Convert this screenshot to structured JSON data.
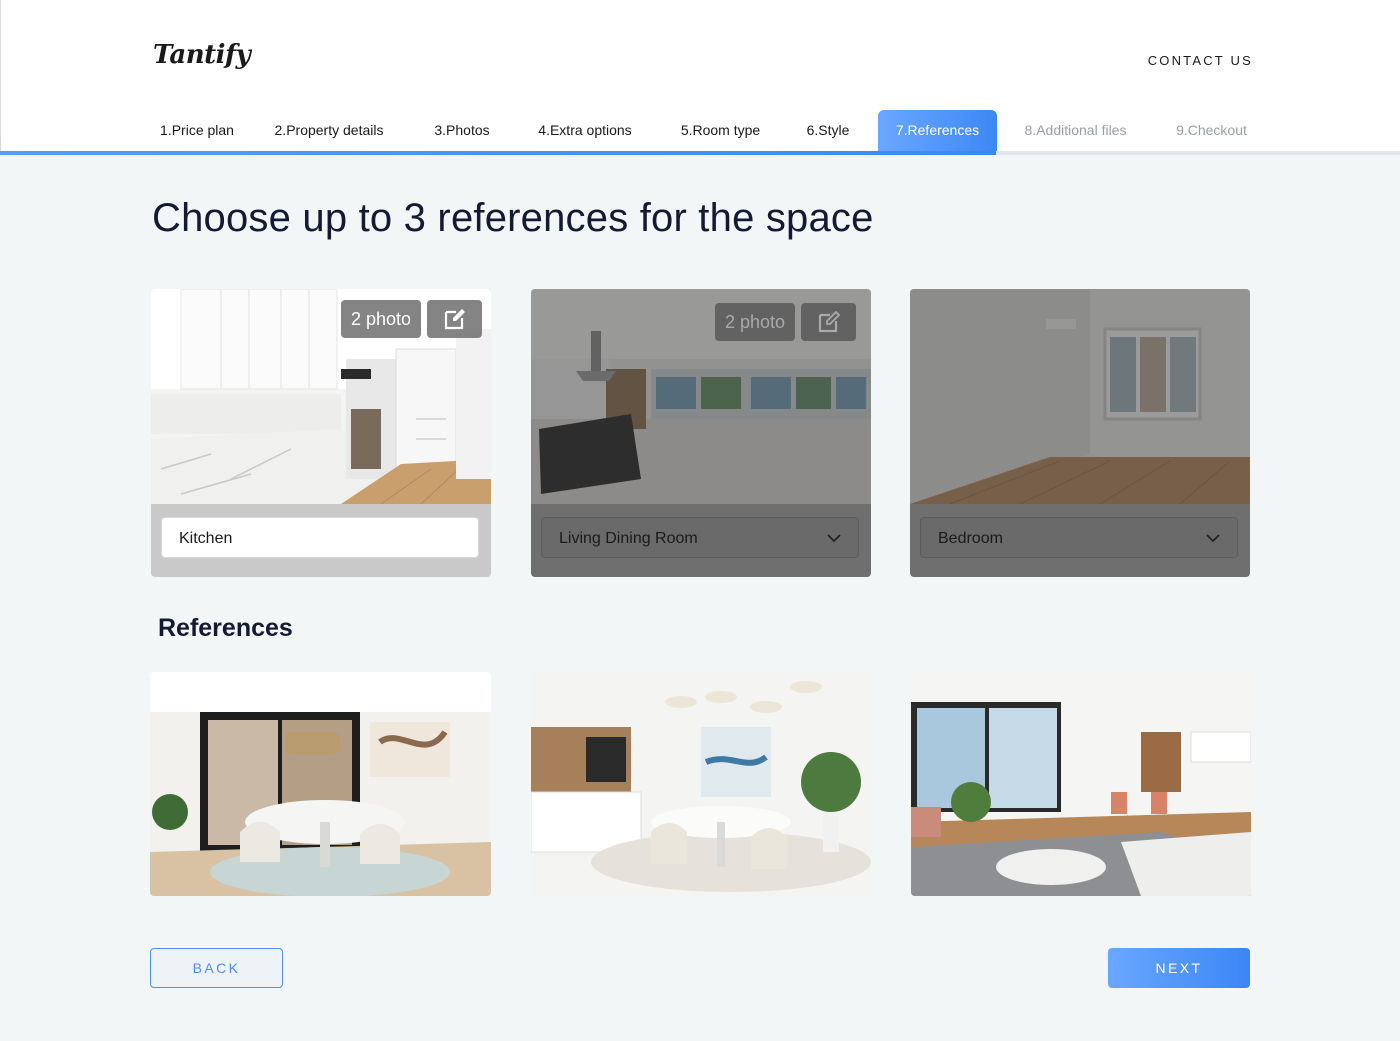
{
  "brand": {
    "logo": "Tantify",
    "contact": "CONTACT US"
  },
  "steps": [
    {
      "label": "1.Price plan",
      "state": "done"
    },
    {
      "label": "2.Property details",
      "state": "done"
    },
    {
      "label": "3.Photos",
      "state": "done"
    },
    {
      "label": "4.Extra options",
      "state": "done"
    },
    {
      "label": "5.Room type",
      "state": "done"
    },
    {
      "label": "6.Style",
      "state": "done"
    },
    {
      "label": "7.References",
      "state": "active"
    },
    {
      "label": "8.Additional files",
      "state": "future"
    },
    {
      "label": "9.Checkout",
      "state": "future"
    }
  ],
  "page": {
    "title": "Choose up to 3 references for the space"
  },
  "rooms": [
    {
      "badge": "2 photo",
      "value": "Kitchen",
      "selected": true,
      "icon": "edit-icon"
    },
    {
      "badge": "2 photo",
      "value": "Living Dining Room",
      "selected": false,
      "icon": "edit-icon"
    },
    {
      "value": "Bedroom",
      "selected": false
    }
  ],
  "references": {
    "title": "References"
  },
  "actions": {
    "back": "BACK",
    "next": "NEXT"
  },
  "colors": {
    "accent": "#3d88f5",
    "accent_light": "#6aa7ff",
    "text": "#141a33",
    "background": "#f3f6f7"
  }
}
